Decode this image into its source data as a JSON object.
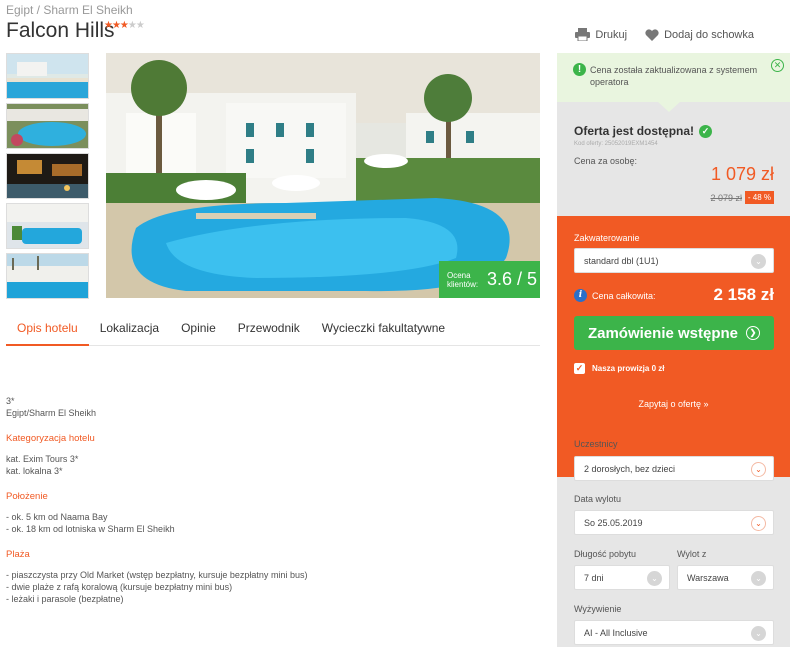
{
  "breadcrumb": "Egipt / Sharm El Sheikh",
  "hotel": {
    "name": "Falcon Hills",
    "stars_filled": 3,
    "stars_total": 5
  },
  "actions": {
    "print": "Drukuj",
    "favorite": "Dodaj do schowka"
  },
  "rating": {
    "label": "Ocena klientów:",
    "value": "3.6 / 5"
  },
  "tabs": [
    "Opis hotelu",
    "Lokalizacja",
    "Opinie",
    "Przewodnik",
    "Wycieczki fakultatywne"
  ],
  "content": {
    "intro": [
      "3*",
      "Egipt/Sharm El Sheikh"
    ],
    "sections": [
      {
        "heading": "Kategoryzacja hotelu",
        "lines": [
          "kat. Exim Tours 3*",
          "kat. lokalna 3*"
        ]
      },
      {
        "heading": "Położenie",
        "lines": [
          "- ok. 5 km od Naama Bay",
          "- ok. 18 km od lotniska w Sharm El Sheikh"
        ]
      },
      {
        "heading": "Plaża",
        "lines": [
          "- piaszczysta przy Old Market (wstęp bezpłatny, kursuje bezpłatny mini bus)",
          "- dwie plaże z rafą koralową (kursuje bezpłatny mini bus)",
          "- leżaki i parasole (bezpłatne)"
        ]
      }
    ]
  },
  "notice": "Cena została zaktualizowana z systemem operatora",
  "offer": {
    "status": "Oferta jest dostępna!",
    "code": "Kod oferty: 25052019EXM1454",
    "per_person_label": "Cena za osobę:",
    "price": "1 079 zł",
    "old_price": "2 079 zł",
    "discount": "- 48 %"
  },
  "booking": {
    "accommodation_label": "Zakwaterowanie",
    "accommodation_value": "standard dbl (1U1)",
    "total_label": "Cena całkowita:",
    "total": "2 158 zł",
    "order_button": "Zamówienie wstępne",
    "commission": "Nasza prowizja 0 zł",
    "ask": "Zapytaj o ofertę »"
  },
  "filters": {
    "participants_label": "Uczestnicy",
    "participants_value": "2 dorosłych, bez dzieci",
    "date_label": "Data wylotu",
    "date_value": "So 25.05.2019",
    "length_label": "Długość pobytu",
    "length_value": "7 dni",
    "departure_label": "Wylot z",
    "departure_value": "Warszawa",
    "board_label": "Wyżywienie",
    "board_value": "AI - All Inclusive"
  },
  "colors": {
    "accent": "#f15a24",
    "green": "#3cb44a",
    "sidebar": "#e6e6e6"
  }
}
